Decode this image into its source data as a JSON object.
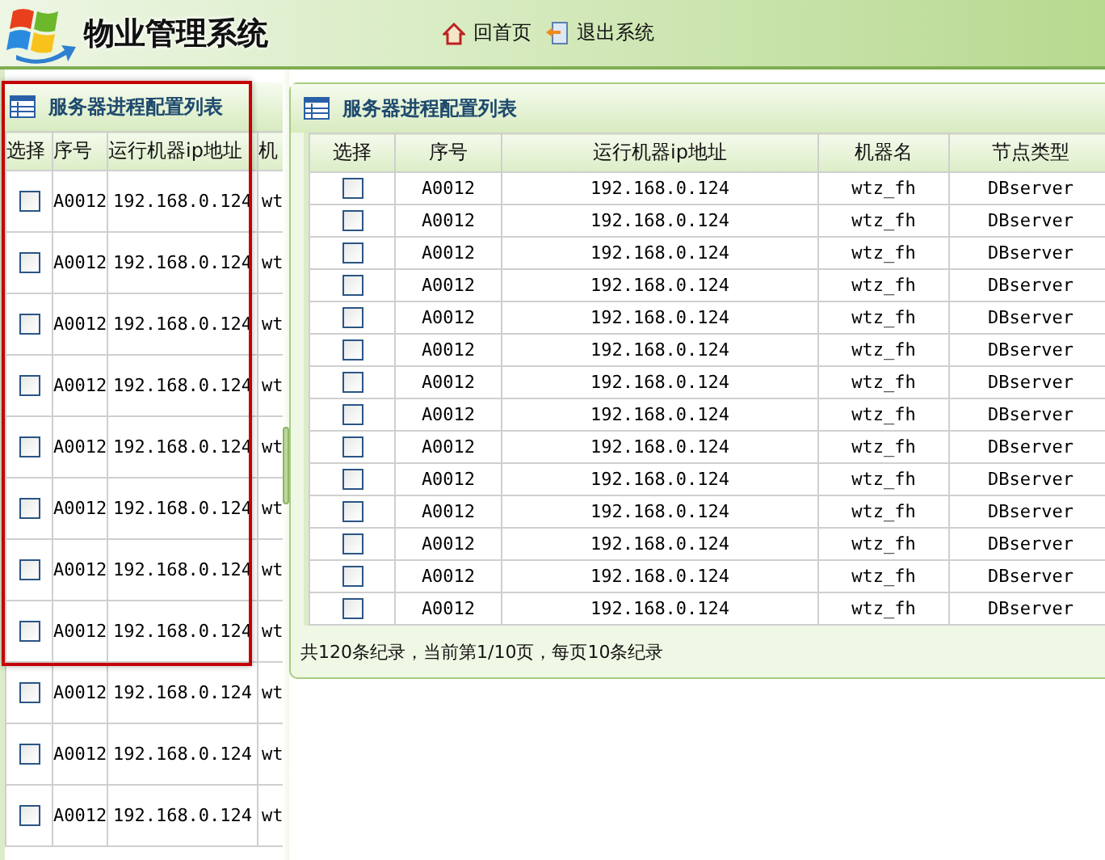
{
  "header": {
    "title": "物业管理系统",
    "nav": [
      {
        "kind": "home",
        "label": "回首页"
      },
      {
        "kind": "exit",
        "label": "退出系统"
      }
    ]
  },
  "left_panel": {
    "title": "服务器进程配置列表",
    "columns": [
      "选择",
      "序号",
      "运行机器ip地址",
      "机"
    ],
    "rows": [
      {
        "checked": false,
        "cells": [
          "",
          "A0012",
          "192.168.0.124",
          "wt"
        ]
      },
      {
        "checked": false,
        "cells": [
          "",
          "A0012",
          "192.168.0.124",
          "wt"
        ]
      },
      {
        "checked": false,
        "cells": [
          "",
          "A0012",
          "192.168.0.124",
          "wt"
        ]
      },
      {
        "checked": false,
        "cells": [
          "",
          "A0012",
          "192.168.0.124",
          "wt"
        ]
      },
      {
        "checked": false,
        "cells": [
          "",
          "A0012",
          "192.168.0.124",
          "wt"
        ]
      },
      {
        "checked": false,
        "cells": [
          "",
          "A0012",
          "192.168.0.124",
          "wt"
        ]
      },
      {
        "checked": false,
        "cells": [
          "",
          "A0012",
          "192.168.0.124",
          "wt"
        ]
      },
      {
        "checked": false,
        "cells": [
          "",
          "A0012",
          "192.168.0.124",
          "wt"
        ]
      },
      {
        "checked": false,
        "cells": [
          "",
          "A0012",
          "192.168.0.124",
          "wt"
        ]
      },
      {
        "checked": false,
        "cells": [
          "",
          "A0012",
          "192.168.0.124",
          "wt"
        ]
      },
      {
        "checked": false,
        "cells": [
          "",
          "A0012",
          "192.168.0.124",
          "wt"
        ]
      }
    ]
  },
  "right_panel": {
    "title": "服务器进程配置列表",
    "columns": [
      "选择",
      "序号",
      "运行机器ip地址",
      "机器名",
      "节点类型"
    ],
    "rows": [
      {
        "checked": false,
        "cells": [
          "",
          "A0012",
          "192.168.0.124",
          "wtz_fh",
          "DBserver"
        ]
      },
      {
        "checked": false,
        "cells": [
          "",
          "A0012",
          "192.168.0.124",
          "wtz_fh",
          "DBserver"
        ]
      },
      {
        "checked": false,
        "cells": [
          "",
          "A0012",
          "192.168.0.124",
          "wtz_fh",
          "DBserver"
        ]
      },
      {
        "checked": false,
        "cells": [
          "",
          "A0012",
          "192.168.0.124",
          "wtz_fh",
          "DBserver"
        ]
      },
      {
        "checked": false,
        "cells": [
          "",
          "A0012",
          "192.168.0.124",
          "wtz_fh",
          "DBserver"
        ]
      },
      {
        "checked": false,
        "cells": [
          "",
          "A0012",
          "192.168.0.124",
          "wtz_fh",
          "DBserver"
        ]
      },
      {
        "checked": false,
        "cells": [
          "",
          "A0012",
          "192.168.0.124",
          "wtz_fh",
          "DBserver"
        ]
      },
      {
        "checked": false,
        "cells": [
          "",
          "A0012",
          "192.168.0.124",
          "wtz_fh",
          "DBserver"
        ]
      },
      {
        "checked": false,
        "cells": [
          "",
          "A0012",
          "192.168.0.124",
          "wtz_fh",
          "DBserver"
        ]
      },
      {
        "checked": false,
        "cells": [
          "",
          "A0012",
          "192.168.0.124",
          "wtz_fh",
          "DBserver"
        ]
      },
      {
        "checked": false,
        "cells": [
          "",
          "A0012",
          "192.168.0.124",
          "wtz_fh",
          "DBserver"
        ]
      },
      {
        "checked": false,
        "cells": [
          "",
          "A0012",
          "192.168.0.124",
          "wtz_fh",
          "DBserver"
        ]
      },
      {
        "checked": false,
        "cells": [
          "",
          "A0012",
          "192.168.0.124",
          "wtz_fh",
          "DBserver"
        ]
      },
      {
        "checked": false,
        "cells": [
          "",
          "A0012",
          "192.168.0.124",
          "wtz_fh",
          "DBserver"
        ]
      }
    ],
    "footer": "共120条纪录，当前第1/10页，每页10条纪录"
  }
}
